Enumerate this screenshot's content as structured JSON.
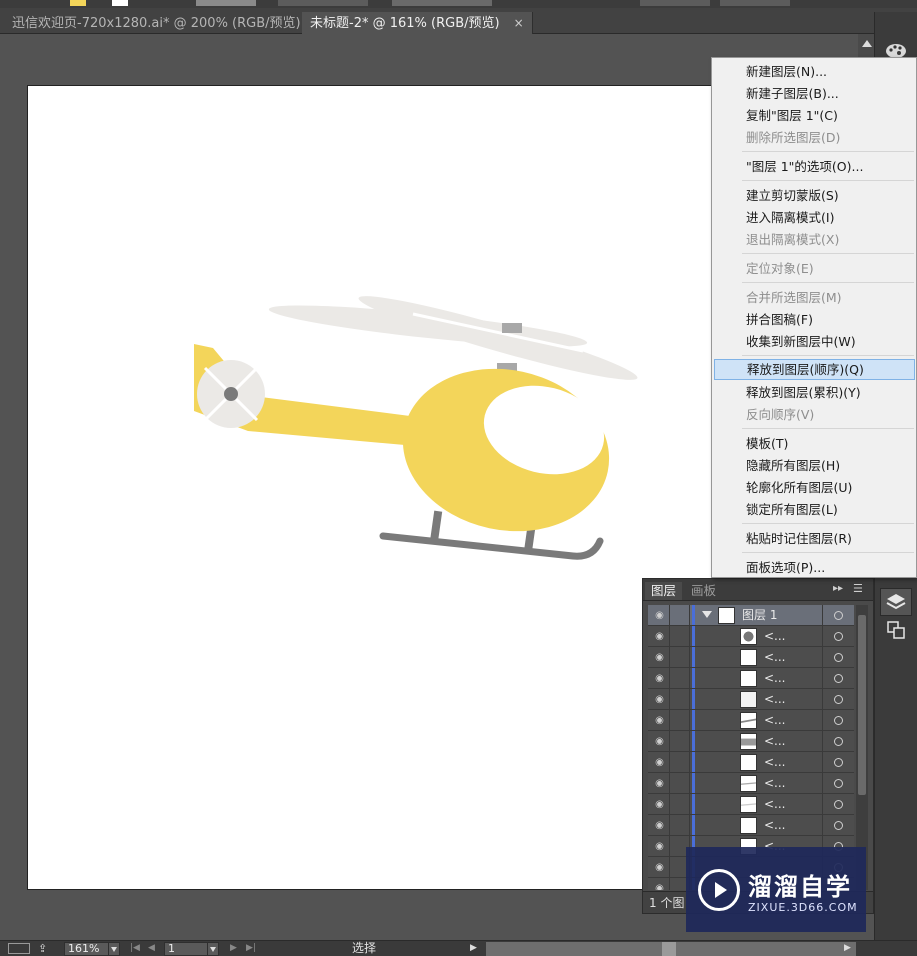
{
  "tabs": [
    {
      "label": "迅信欢迎页-720x1280.ai* @ 200% (RGB/预览)",
      "close": "×"
    },
    {
      "label": "未标题-2* @ 161% (RGB/预览)",
      "close": "×"
    }
  ],
  "context_menu": {
    "items": [
      {
        "label": "新建图层(N)...",
        "disabled": false
      },
      {
        "label": "新建子图层(B)...",
        "disabled": false
      },
      {
        "label": "复制\"图层 1\"(C)",
        "disabled": false
      },
      {
        "label": "删除所选图层(D)",
        "disabled": true
      },
      {
        "label": "\"图层 1\"的选项(O)...",
        "disabled": false
      },
      {
        "label": "建立剪切蒙版(S)",
        "disabled": false
      },
      {
        "label": "进入隔离模式(I)",
        "disabled": false
      },
      {
        "label": "退出隔离模式(X)",
        "disabled": true
      },
      {
        "label": "定位对象(E)",
        "disabled": true
      },
      {
        "label": "合并所选图层(M)",
        "disabled": true
      },
      {
        "label": "拼合图稿(F)",
        "disabled": false
      },
      {
        "label": "收集到新图层中(W)",
        "disabled": false
      },
      {
        "label": "释放到图层(顺序)(Q)",
        "disabled": false,
        "highlighted": true
      },
      {
        "label": "释放到图层(累积)(Y)",
        "disabled": false
      },
      {
        "label": "反向顺序(V)",
        "disabled": true
      },
      {
        "label": "模板(T)",
        "disabled": false
      },
      {
        "label": "隐藏所有图层(H)",
        "disabled": false
      },
      {
        "label": "轮廓化所有图层(U)",
        "disabled": false
      },
      {
        "label": "锁定所有图层(L)",
        "disabled": false
      },
      {
        "label": "粘贴时记住图层(R)",
        "disabled": false
      },
      {
        "label": "面板选项(P)...",
        "disabled": false
      }
    ]
  },
  "layers_panel": {
    "tab_active": "图层",
    "tab_inactive": "画板",
    "parent_layer": "图层 1",
    "sublayer_label": "<...",
    "footer_count": "1 个图"
  },
  "status_bar": {
    "zoom": "161%",
    "artboard": "1",
    "mode": "选择"
  },
  "watermark": {
    "brand": "溜溜自学",
    "url": "ZIXUE.3D66.COM"
  },
  "colors": {
    "helicopter_body": "#f3d55a",
    "rotor": "#ebe9e6",
    "skid": "#7a7a7a",
    "menu_highlight": "#cfe3f7",
    "layer_bar": "#4a6ed8"
  }
}
